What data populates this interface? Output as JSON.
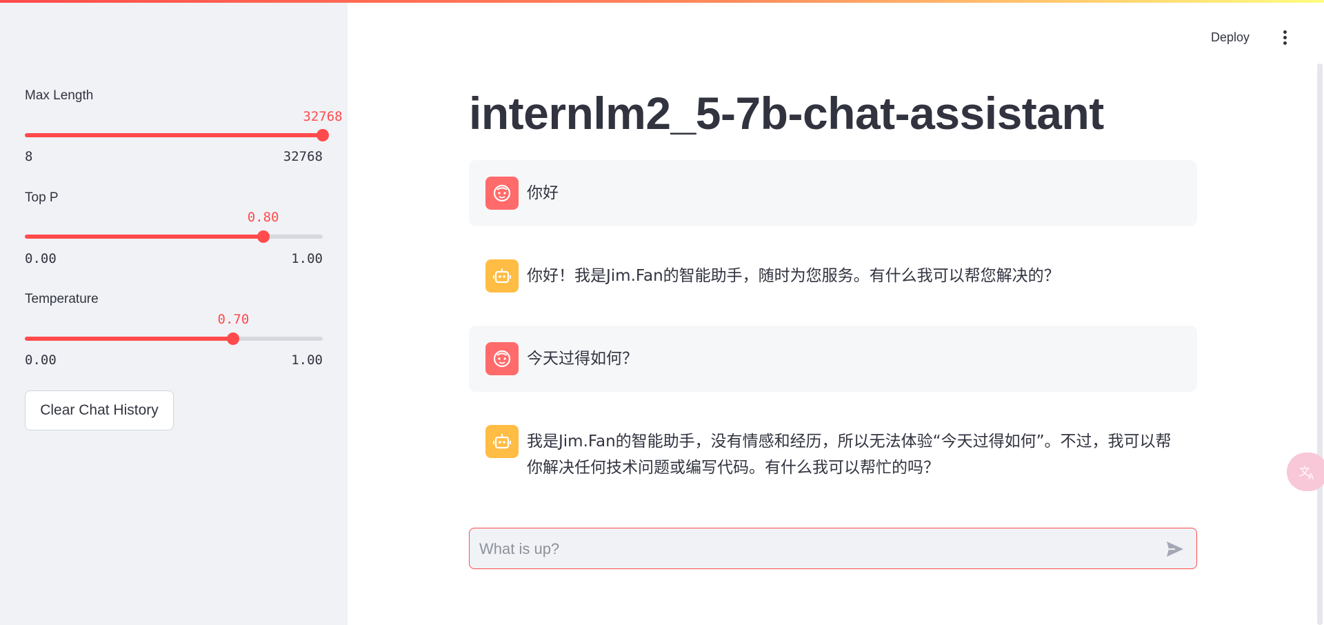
{
  "sidebar": {
    "sliders": [
      {
        "label": "Max Length",
        "value": "32768",
        "min": "8",
        "max": "32768",
        "fraction": 1.0
      },
      {
        "label": "Top P",
        "value": "0.80",
        "min": "0.00",
        "max": "1.00",
        "fraction": 0.8
      },
      {
        "label": "Temperature",
        "value": "0.70",
        "min": "0.00",
        "max": "1.00",
        "fraction": 0.7
      }
    ],
    "clear_button": "Clear Chat History"
  },
  "header": {
    "deploy_label": "Deploy",
    "menu_icon": "more-vertical-icon"
  },
  "main": {
    "title": "internlm2_5-7b-chat-assistant",
    "messages": [
      {
        "role": "user",
        "avatar_icon": "user-face-icon",
        "text": "你好"
      },
      {
        "role": "assistant",
        "avatar_icon": "robot-icon",
        "text": "你好！我是Jim.Fan的智能助手，随时为您服务。有什么我可以帮您解决的？"
      },
      {
        "role": "user",
        "avatar_icon": "user-face-icon",
        "text": "今天过得如何？"
      },
      {
        "role": "assistant",
        "avatar_icon": "robot-icon",
        "text": "我是Jim.Fan的智能助手，没有情感和经历，所以无法体验“今天过得如何”。不过，我可以帮你解决任何技术问题或编写代码。有什么我可以帮忙的吗？"
      }
    ],
    "input": {
      "placeholder": "What is up?",
      "value": "",
      "send_icon": "send-icon"
    }
  },
  "colors": {
    "accent": "#ff4b4b",
    "sidebar_bg": "#f0f2f6",
    "user_avatar": "#ff6b6b",
    "bot_avatar": "#ffbd45",
    "text": "#31333f"
  },
  "floating_widget": {
    "icon": "translate-icon"
  }
}
